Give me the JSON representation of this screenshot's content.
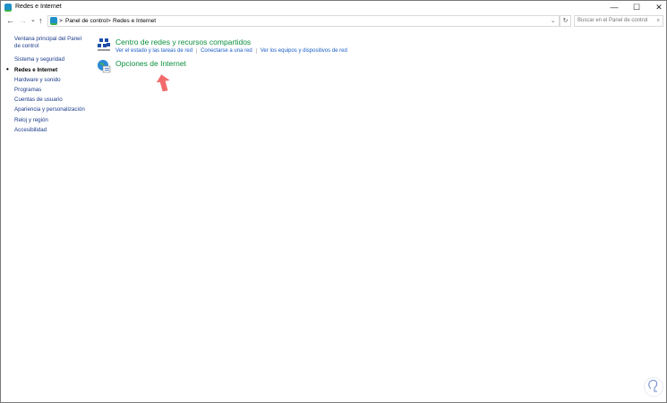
{
  "window": {
    "title": "Redes e Internet",
    "minimize": "—",
    "maximize": "☐",
    "close": "✕"
  },
  "address": {
    "back": "←",
    "forward": "→",
    "recent": "⌄",
    "up": "↑",
    "crumbs": [
      "Panel de control",
      "Redes e Internet"
    ],
    "sep": ">",
    "dropdown": "⌄",
    "refresh": "↻",
    "search_placeholder": "Buscar en el Panel de control",
    "search_icon": "⌕"
  },
  "sidebar": {
    "items": [
      {
        "label": "Ventana principal del Panel de control"
      },
      {
        "label": "Sistema y seguridad"
      },
      {
        "label": "Redes e Internet",
        "current": true
      },
      {
        "label": "Hardware y sonido"
      },
      {
        "label": "Programas"
      },
      {
        "label": "Cuentas de usuario"
      },
      {
        "label": "Apariencia y personalización"
      },
      {
        "label": "Reloj y región"
      },
      {
        "label": "Accesibilidad"
      }
    ]
  },
  "main": {
    "categories": [
      {
        "title": "Centro de redes y recursos compartidos",
        "icon": "network-icon",
        "links": [
          "Ver el estado y las tareas de red",
          "Conectarse a una red",
          "Ver los equipos y dispositivos de red"
        ]
      },
      {
        "title": "Opciones de Internet",
        "icon": "internet-options-icon",
        "links": []
      }
    ]
  },
  "colors": {
    "heading": "#0a8f3c",
    "link": "#1a5ec8",
    "arrow": "#f26b6b"
  }
}
